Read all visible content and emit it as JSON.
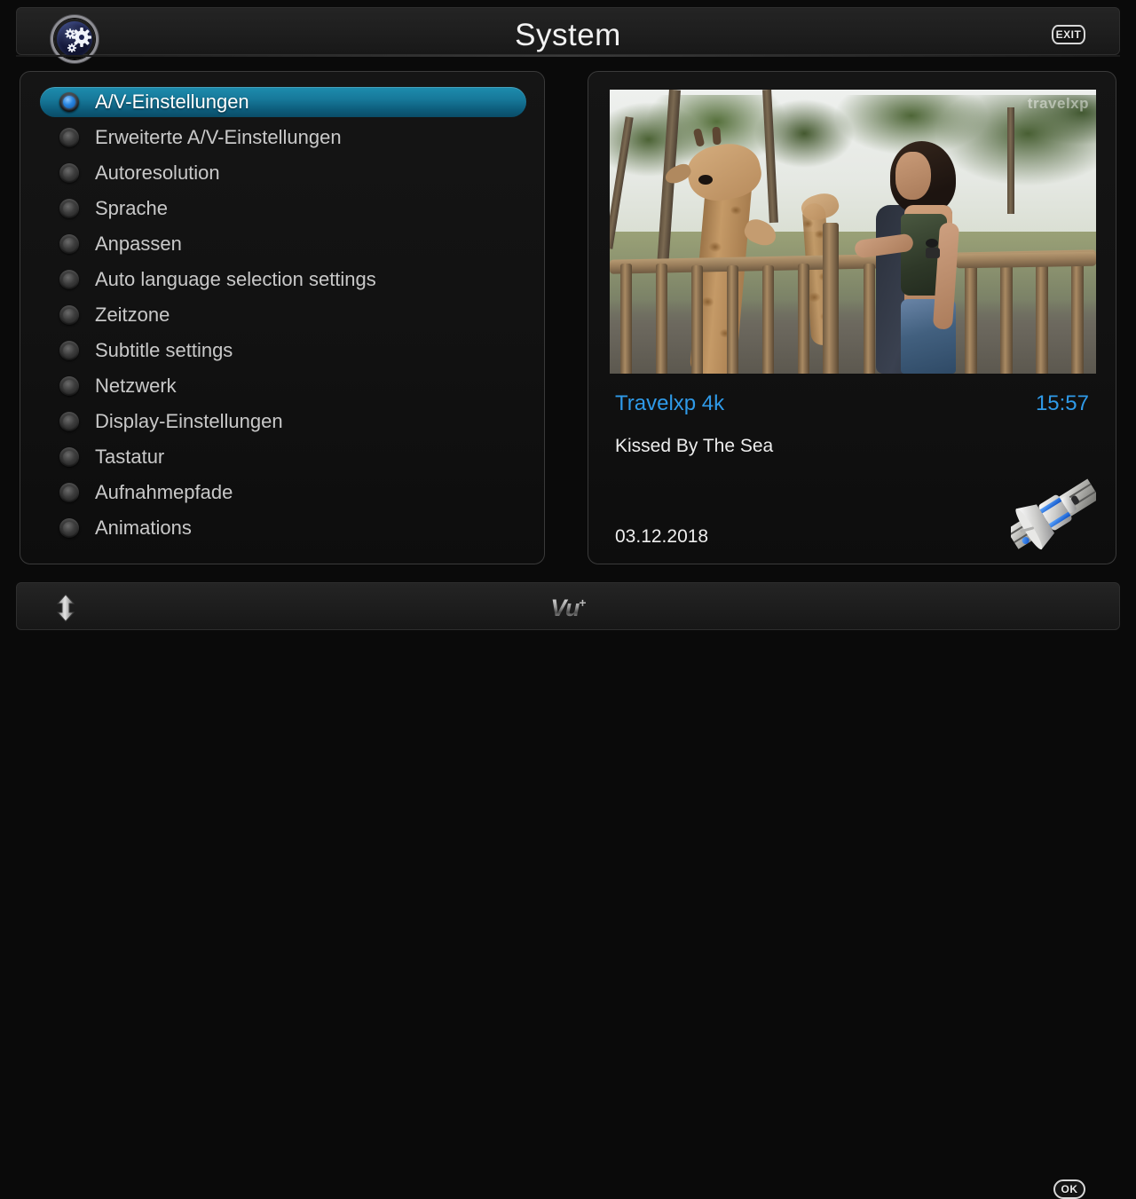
{
  "header": {
    "title": "System",
    "logo_icon": "gear-badge-icon",
    "exit_label": "EXIT"
  },
  "menu": {
    "items": [
      {
        "label": "A/V-Einstellungen",
        "selected": true
      },
      {
        "label": "Erweiterte A/V-Einstellungen",
        "selected": false
      },
      {
        "label": "Autoresolution",
        "selected": false
      },
      {
        "label": "Sprache",
        "selected": false
      },
      {
        "label": "Anpassen",
        "selected": false
      },
      {
        "label": "Auto language selection settings",
        "selected": false
      },
      {
        "label": "Zeitzone",
        "selected": false
      },
      {
        "label": "Subtitle settings",
        "selected": false
      },
      {
        "label": "Netzwerk",
        "selected": false
      },
      {
        "label": "Display-Einstellungen",
        "selected": false
      },
      {
        "label": "Tastatur",
        "selected": false
      },
      {
        "label": "Aufnahmepfade",
        "selected": false
      },
      {
        "label": "Animations",
        "selected": false
      }
    ]
  },
  "preview": {
    "watermark": "travelxp",
    "channel_name": "Travelxp 4k",
    "clock": "15:57",
    "program_title": "Kissed By The Sea",
    "event_date": "03.12.2018",
    "satellite_icon": "satellite-icon"
  },
  "footer": {
    "updown_icon": "up-down-arrow-icon",
    "brand": "Vu",
    "brand_plus": "+",
    "ok_label": "OK"
  },
  "colors": {
    "accent_blue": "#2f9ae8",
    "highlight_top": "#1d8cae",
    "highlight_bottom": "#0a4c67",
    "background": "#0a0a0a",
    "panel": "#111111",
    "text_primary": "#ededed",
    "text_muted": "#c9c9c9"
  }
}
